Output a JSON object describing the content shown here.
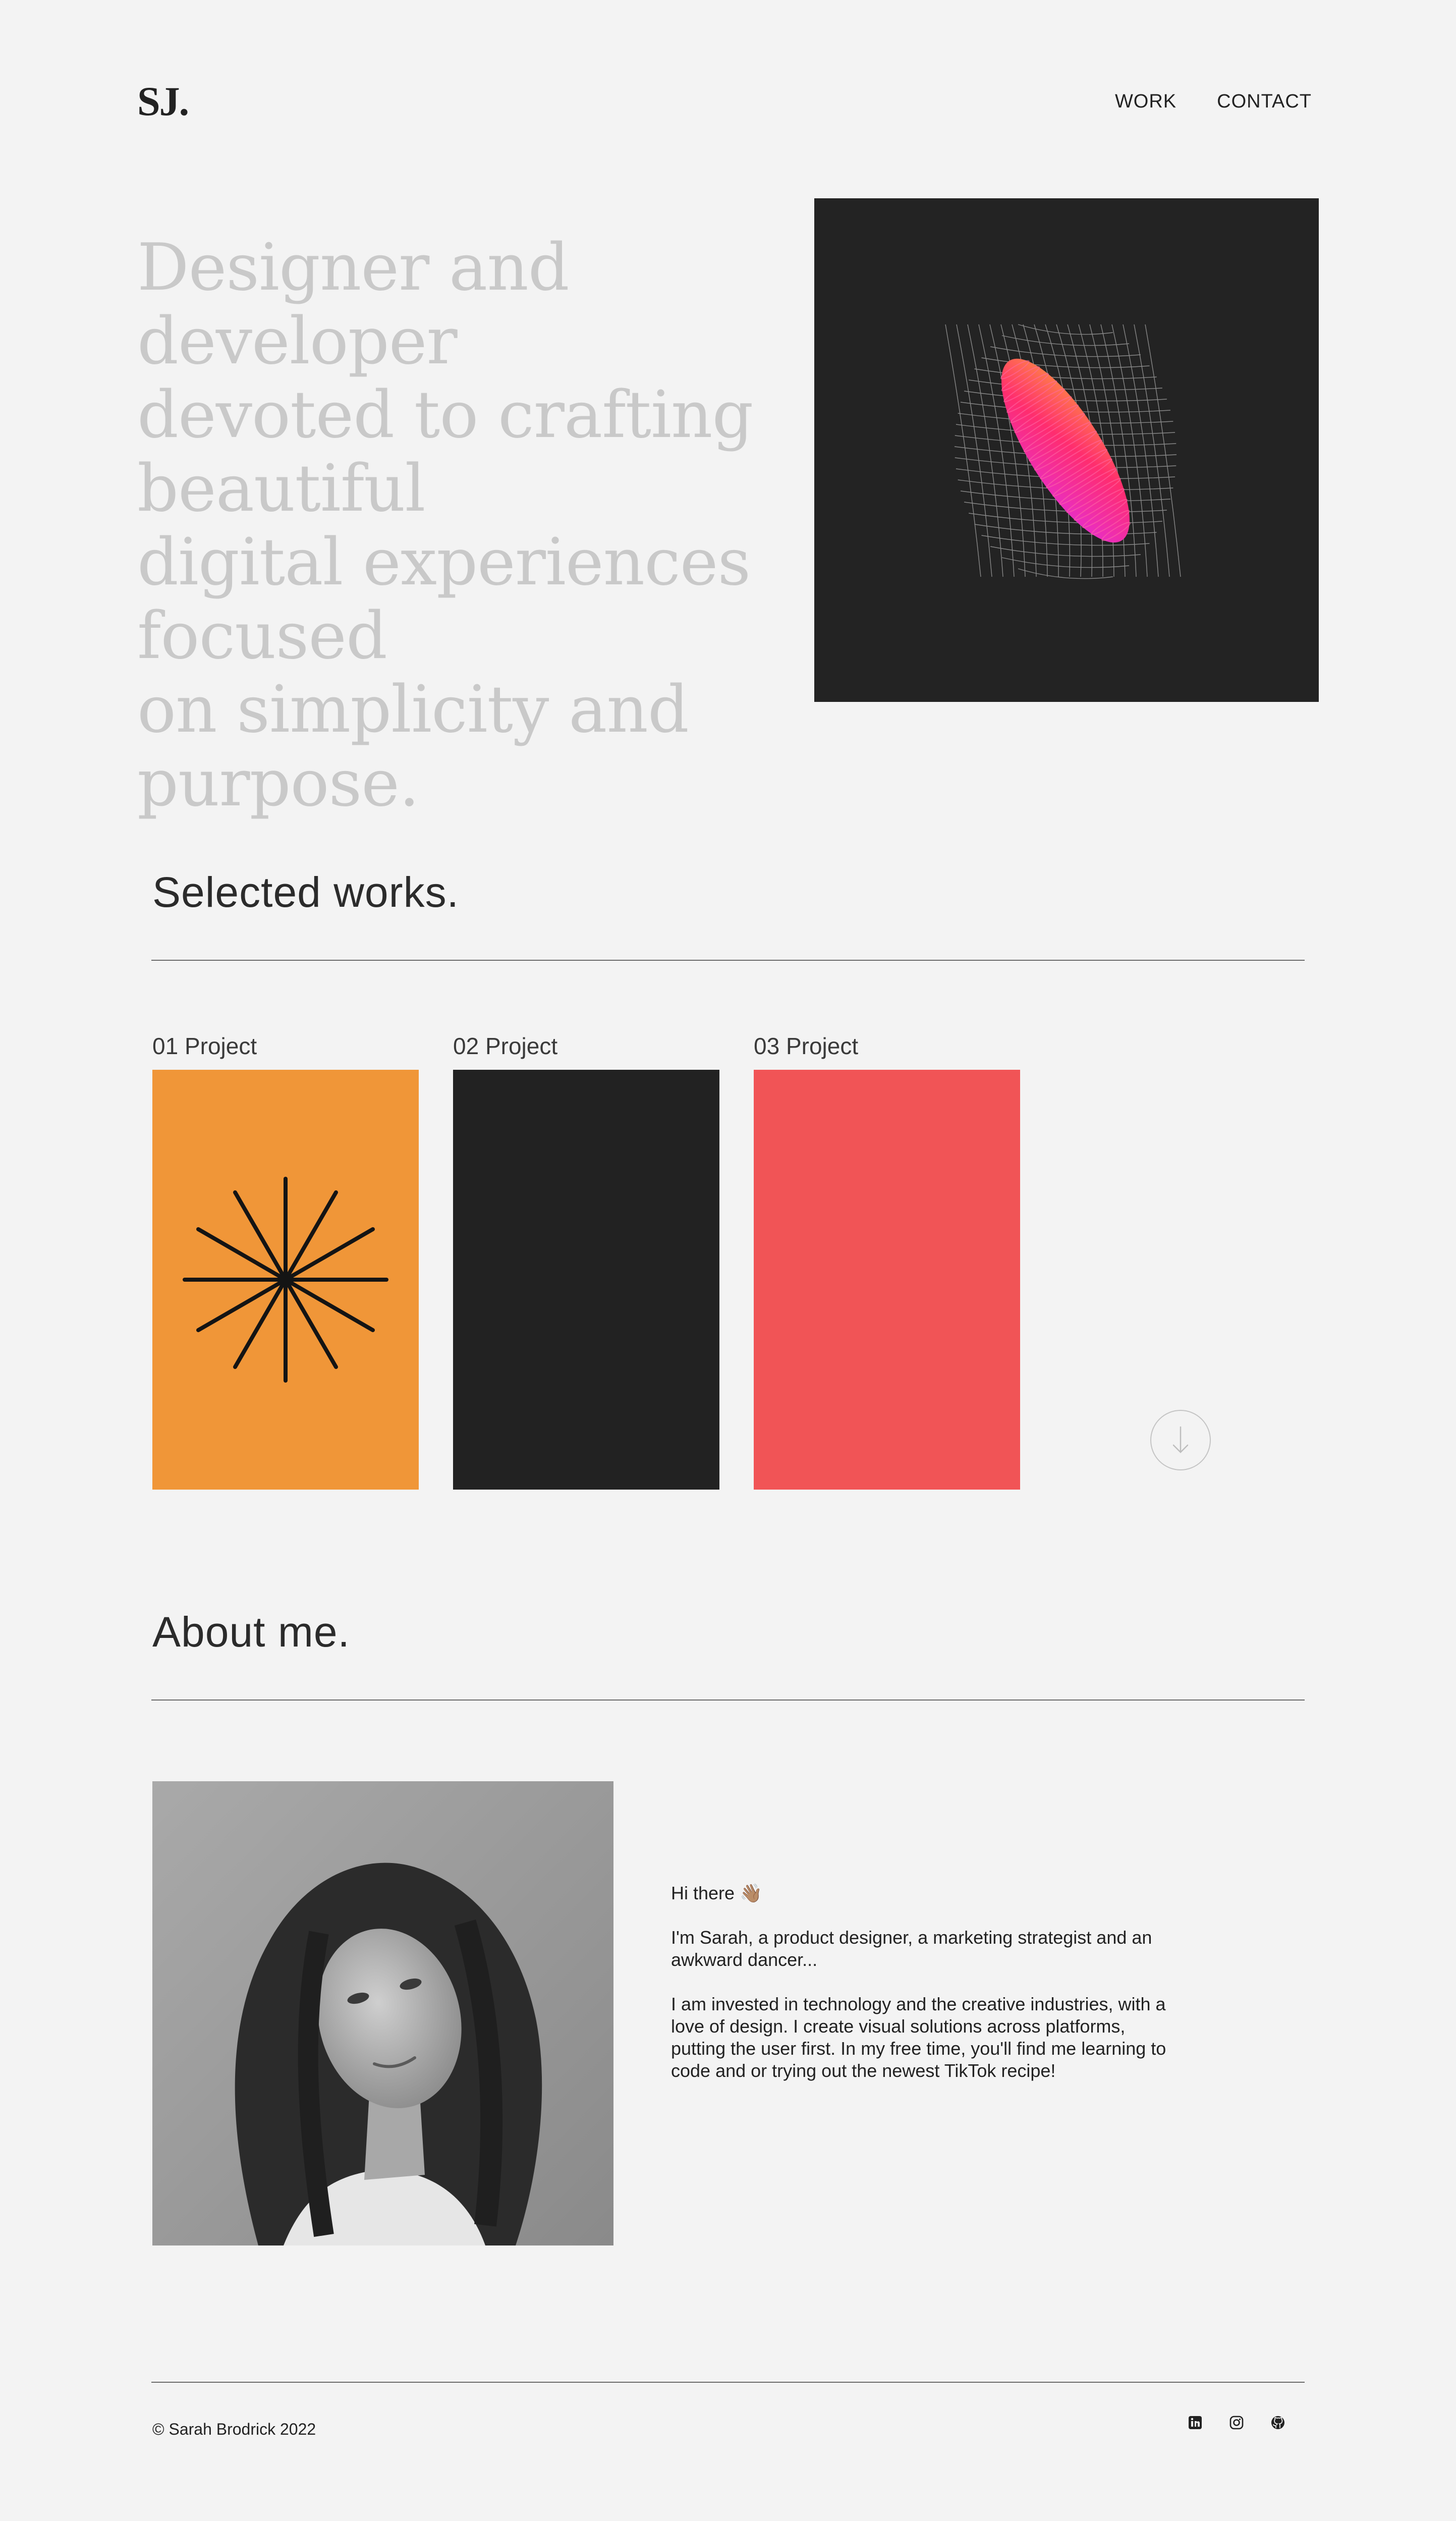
{
  "header": {
    "logo": "SJ.",
    "nav": [
      "WORK",
      "CONTACT"
    ]
  },
  "hero": {
    "lines": [
      "Designer and developer",
      "devoted to crafting beautiful",
      "digital experiences focused",
      "on simplicity and purpose."
    ]
  },
  "works": {
    "title": "Selected works.",
    "projects": [
      {
        "label": "01 Project",
        "color": "#f09638"
      },
      {
        "label": "02 Project",
        "color": "#222222"
      },
      {
        "label": "03 Project",
        "color": "#f15456"
      }
    ]
  },
  "about": {
    "title": "About me.",
    "paragraphs": [
      "Hi there 👋🏽",
      "I'm Sarah, a product designer, a marketing strategist and an awkward dancer...",
      "I am invested in technology and the creative industries, with a love of design. I create visual solutions across platforms, putting the user first. In my free time, you'll find me learning to code and or trying out the newest TikTok recipe!"
    ]
  },
  "footer": {
    "copyright": "© Sarah Brodrick 2022",
    "social_icons": [
      "linkedin-icon",
      "instagram-icon",
      "github-icon"
    ]
  },
  "colors": {
    "background": "#f3f3f3",
    "text": "#232323",
    "hero_panel": "#232323",
    "gradient_start": "#ff9a3c",
    "gradient_mid": "#ff2d6e",
    "gradient_end": "#e22ee0"
  }
}
